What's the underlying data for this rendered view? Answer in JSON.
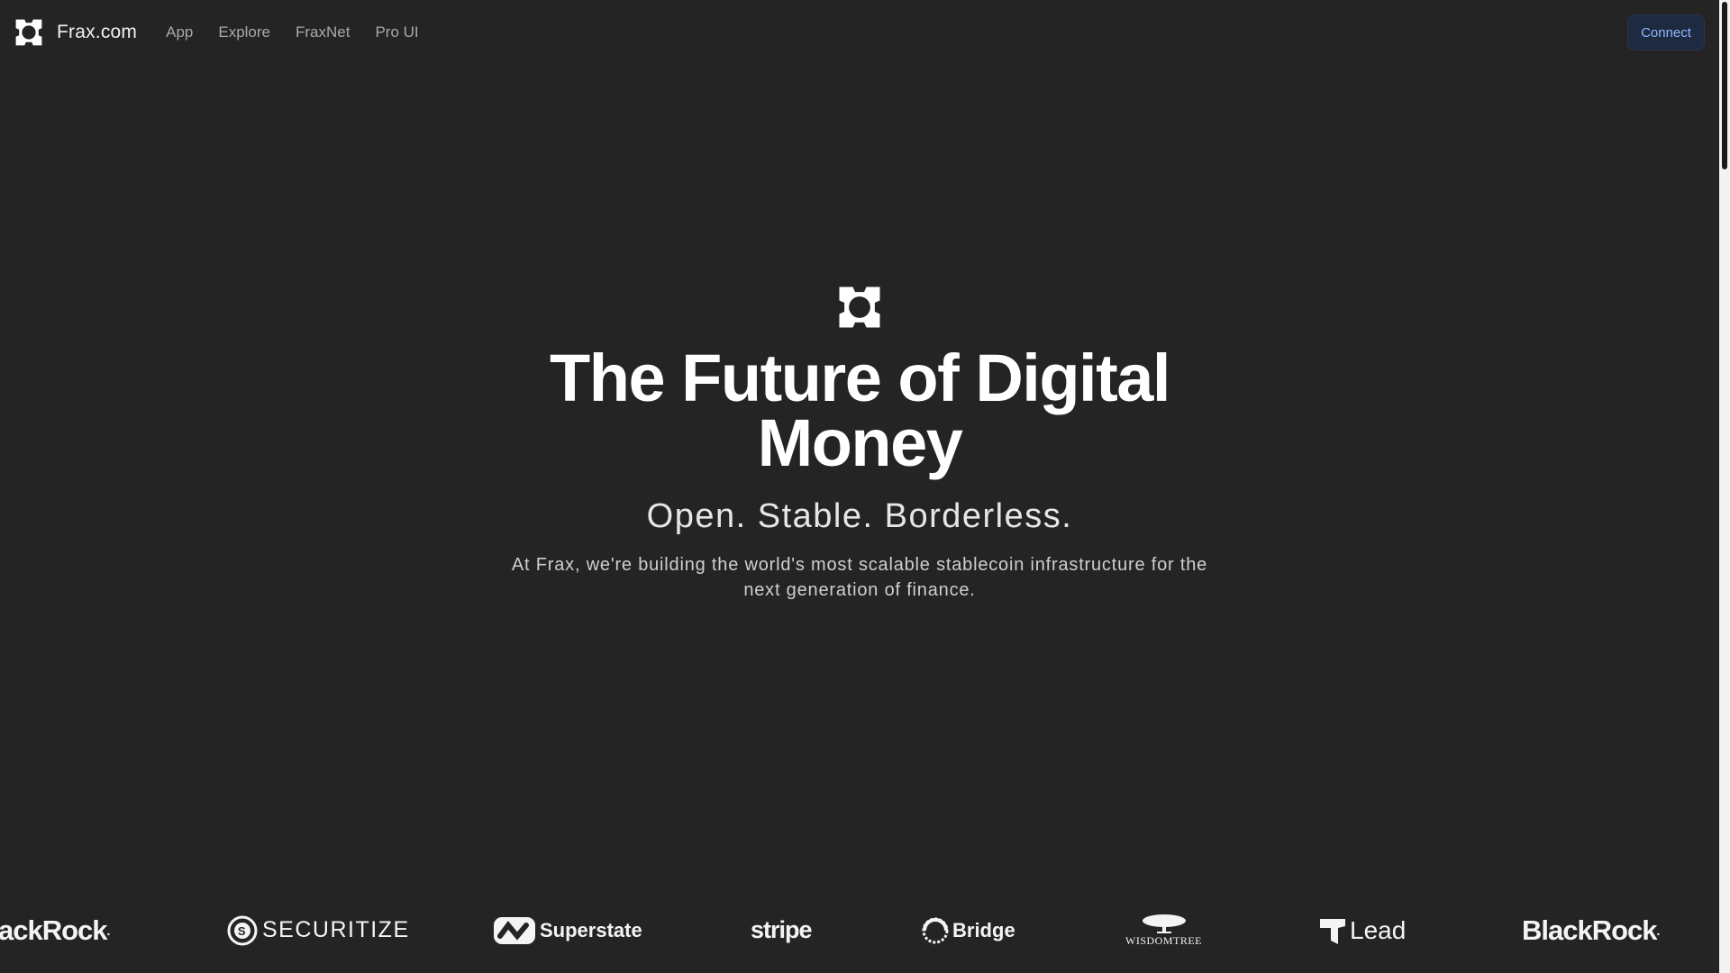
{
  "nav": {
    "brand_name": "Frax.com",
    "links": [
      {
        "label": "App"
      },
      {
        "label": "Explore"
      },
      {
        "label": "FraxNet"
      },
      {
        "label": "Pro UI"
      }
    ],
    "connect_label": "Connect"
  },
  "hero": {
    "title": "The Future of Digital Money",
    "tagline": "Open. Stable. Borderless.",
    "description": "At Frax, we're building the world's most scalable stablecoin infrastructure for the next generation of finance."
  },
  "partners": {
    "blackrock_partial": "ackRock",
    "securitize": "SECURITIZE",
    "superstate": "Superstate",
    "stripe": "stripe",
    "bridge": "Bridge",
    "wisdomtree": "WISDOMTREE",
    "lead": "Lead",
    "blackrock": "BlackRock"
  },
  "colors": {
    "background": "#242424",
    "connect_bg": "#1d2a40",
    "connect_text": "#8fb7ff",
    "nav_link": "#a9a9a9"
  },
  "icons": {
    "brand": "frax-logo-icon",
    "hero": "frax-logo-icon"
  }
}
